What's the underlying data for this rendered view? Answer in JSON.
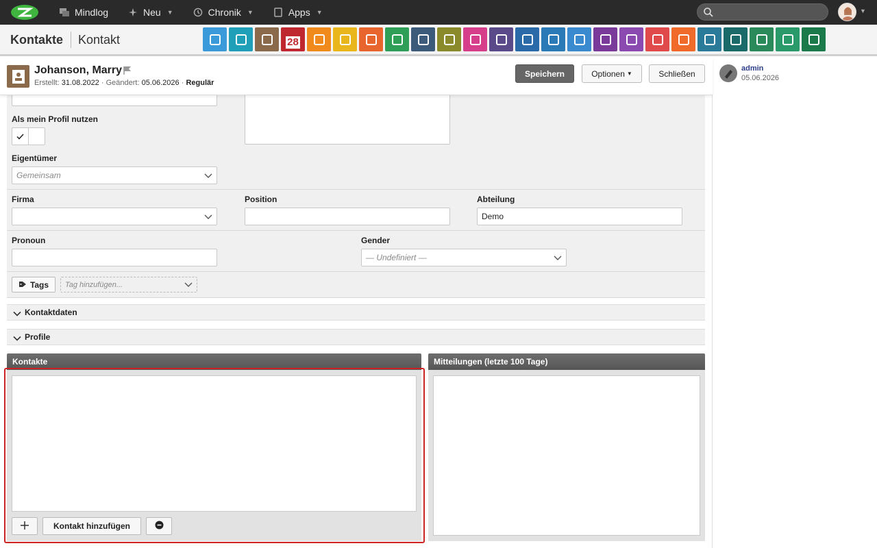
{
  "topbar": {
    "nav": [
      {
        "label": "Mindlog"
      },
      {
        "label": "Neu"
      },
      {
        "label": "Chronik"
      },
      {
        "label": "Apps"
      }
    ],
    "search_placeholder": ""
  },
  "breadcrumb": {
    "module": "Kontakte",
    "page": "Kontakt"
  },
  "app_icons": [
    {
      "name": "email-icon",
      "color": "#3b9ad9"
    },
    {
      "name": "address-book-icon",
      "color": "#1fa0b8"
    },
    {
      "name": "contacts-icon",
      "color": "#8a6a4a"
    },
    {
      "name": "calendar-icon",
      "color": "#c0282f",
      "text": "28"
    },
    {
      "name": "timer-icon",
      "color": "#f08a1c"
    },
    {
      "name": "tasks-icon",
      "color": "#e9b61c"
    },
    {
      "name": "projects-icon",
      "color": "#e8652d"
    },
    {
      "name": "notes-icon",
      "color": "#2f9e57"
    },
    {
      "name": "bookmark-icon",
      "color": "#3c5a7a"
    },
    {
      "name": "documents-icon",
      "color": "#8a8a2a"
    },
    {
      "name": "reception-icon",
      "color": "#d63d8b"
    },
    {
      "name": "finance-icon",
      "color": "#5a4a8a"
    },
    {
      "name": "delivery-icon",
      "color": "#2a6aa8"
    },
    {
      "name": "support-icon",
      "color": "#2a7ab8"
    },
    {
      "name": "money-bag-icon",
      "color": "#3a8ad0"
    },
    {
      "name": "contracts-icon",
      "color": "#7a3a9a"
    },
    {
      "name": "deals-icon",
      "color": "#8a4ab0"
    },
    {
      "name": "pdf-icon",
      "color": "#e04a4a"
    },
    {
      "name": "broadcast-icon",
      "color": "#f06a2a"
    },
    {
      "name": "download-icon",
      "color": "#2a7a9a"
    },
    {
      "name": "shipping-icon",
      "color": "#1a6a6a"
    },
    {
      "name": "cash-icon",
      "color": "#2a8a5a"
    },
    {
      "name": "price-tag-icon",
      "color": "#2a9a6a"
    },
    {
      "name": "database-icon",
      "color": "#1a7a4a"
    }
  ],
  "record": {
    "name": "Johanson, Marry",
    "created_label": "Erstellt:",
    "created": "31.08.2022",
    "changed_label": "Geändert:",
    "changed": "05.06.2026",
    "status": "Regulär",
    "sep": "·"
  },
  "actions": {
    "save": "Speichern",
    "options": "Optionen",
    "close": "Schließen"
  },
  "sidebar": {
    "user": "admin",
    "date": "05.06.2026"
  },
  "form": {
    "use_profile_label": "Als mein Profil nutzen",
    "owner_label": "Eigentümer",
    "owner_value": "Gemeinsam",
    "company_label": "Firma",
    "company_value": "",
    "position_label": "Position",
    "position_value": "",
    "department_label": "Abteilung",
    "department_value": "Demo",
    "pronoun_label": "Pronoun",
    "pronoun_value": "",
    "gender_label": "Gender",
    "gender_value": "— Undefiniert —",
    "tags_label": "Tags",
    "tags_placeholder": "Tag hinzufügen..."
  },
  "sections": {
    "contact_data": "Kontaktdaten",
    "profile": "Profile"
  },
  "panels": {
    "contacts": {
      "title": "Kontakte",
      "add_label": "Kontakt hinzufügen"
    },
    "messages": {
      "title": "Mitteilungen (letzte 100 Tage)"
    }
  }
}
